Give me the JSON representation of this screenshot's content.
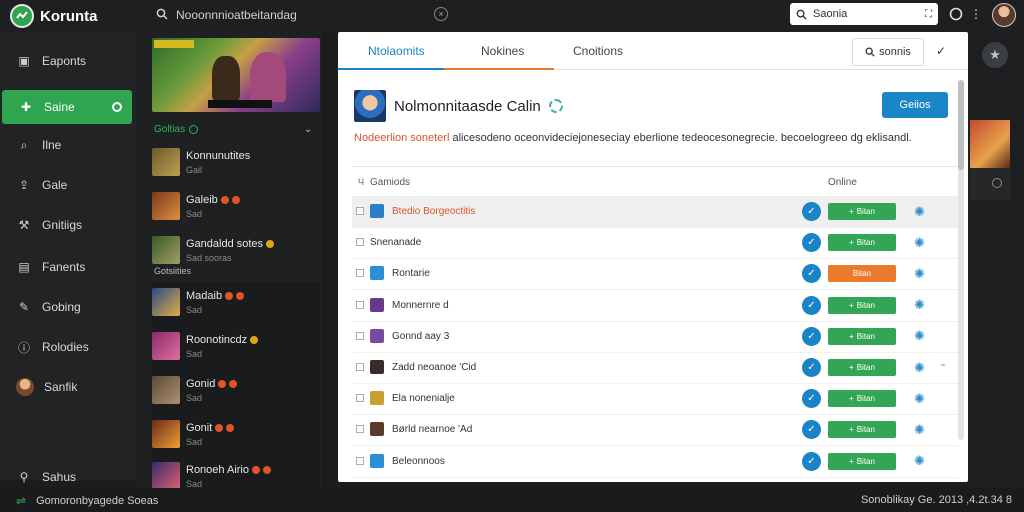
{
  "app": {
    "name": "Korunta"
  },
  "topbar": {
    "search_text": "Nooonnnioatbeitandag",
    "search_box_placeholder": "Saonia",
    "icons": [
      "search-icon",
      "close-icon",
      "expand-icon",
      "chat-icon",
      "more-icon"
    ]
  },
  "nav": {
    "items": [
      {
        "label": "Eaponts",
        "icon": "disk-icon"
      },
      {
        "label": "Saine",
        "icon": "gamepad-icon",
        "active": true
      },
      {
        "label": "Ilne",
        "icon": "search-icon"
      },
      {
        "label": "Gale",
        "icon": "upload-icon"
      },
      {
        "label": "Gnitiigs",
        "icon": "tools-icon"
      },
      {
        "label": "Fanents",
        "icon": "calendar-icon"
      },
      {
        "label": "Gobing",
        "icon": "wrench-icon"
      },
      {
        "label": "Rolodies",
        "icon": "info-icon"
      },
      {
        "label": "Sanfik",
        "icon": "avatar"
      }
    ],
    "bottom_item": {
      "label": "Sahus",
      "icon": "person-icon"
    }
  },
  "games": {
    "section_label": "Goltias",
    "subheader": "Gotsiities",
    "list": [
      {
        "name": "Konnunutites",
        "sub": "Gail",
        "badges": []
      },
      {
        "name": "Galeib",
        "sub": "Sad",
        "badges": [
          "r",
          "r"
        ]
      },
      {
        "name": "Gandaldd sotes",
        "sub": "Sad sooras",
        "badges": [
          "y"
        ]
      },
      {
        "name": "Madaib",
        "sub": "Sad",
        "badges": [
          "r",
          "r"
        ]
      },
      {
        "name": "Roonotincdz",
        "sub": "Sad",
        "badges": [
          "y"
        ]
      },
      {
        "name": "Gonid",
        "sub": "Sad",
        "badges": [
          "r",
          "r"
        ]
      },
      {
        "name": "Gonit",
        "sub": "Sad",
        "badges": [
          "r",
          "r"
        ]
      },
      {
        "name": "Ronoeh Airio",
        "sub": "Sad",
        "badges": [
          "r",
          "r"
        ]
      }
    ]
  },
  "panel": {
    "tabs": [
      "Ntolaomits",
      "Nokines",
      "Cnoitions"
    ],
    "search_button": "sonnis",
    "title": "Nolmonnitaasde Calin",
    "primary_button": "Geiios",
    "description_highlight": "Nodeerlion soneterl",
    "description_rest": "alicesodeno oceonvideciejoneseciay eberlione tedeocesonegrecie. becoelogreeo dg eklisandl.",
    "table": {
      "col_name": "Gamiods",
      "col_online": "Online",
      "rows": [
        {
          "name": "Btedio Borgeoctitis",
          "icon_color": "#2a7fc8",
          "error": true,
          "status": "Bitan",
          "status_type": "ok",
          "selected": true
        },
        {
          "name": "Snenanade",
          "icon_color": "",
          "status": "Bitan",
          "status_type": "ok"
        },
        {
          "name": "Rontarie",
          "icon_color": "#2a8fd6",
          "status": "Bitan",
          "status_type": "warn"
        },
        {
          "name": "Monnernre d",
          "icon_color": "#6a3a8a",
          "status": "Bitan",
          "status_type": "ok"
        },
        {
          "name": "Gonnd aay 3",
          "icon_color": "#7a4aa0",
          "status": "Bitan",
          "status_type": "ok"
        },
        {
          "name": "Zadd neoanoe 'Cid",
          "icon_color": "#3a2a2a",
          "status": "Bitan",
          "status_type": "ok",
          "extra": true
        },
        {
          "name": "Ela nonenialje",
          "icon_color": "#c8a030",
          "status": "Bitan",
          "status_type": "ok"
        },
        {
          "name": "Børld nearnoe 'Ad",
          "icon_color": "#5a3a2a",
          "status": "Bitan",
          "status_type": "ok"
        },
        {
          "name": "Beleonnoos",
          "icon_color": "#2a8fd6",
          "status": "Bitan",
          "status_type": "ok"
        }
      ]
    }
  },
  "statusbar": {
    "left": "Gomoronbyagede Soeas",
    "right": "Sonoblikay Ge. 2013 ,4.2t.34 8"
  },
  "colors": {
    "accent": "#2fa552",
    "primary": "#1a86c7",
    "warning": "#ea7a2c",
    "error": "#e0542a"
  }
}
